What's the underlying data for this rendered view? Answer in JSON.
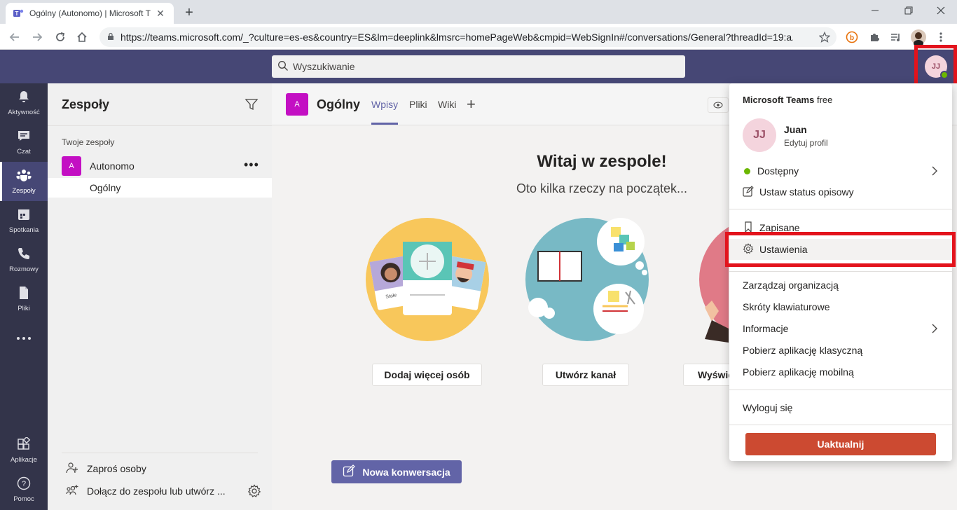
{
  "browser": {
    "tab_title": "Ogólny (Autonomo) | Microsoft T",
    "url": "https://teams.microsoft.com/_?culture=es-es&country=ES&lm=deeplink&lmsrc=homePageWeb&cmpid=WebSignIn#/conversations/General?threadId=19:a..."
  },
  "header": {
    "search_placeholder": "Wyszukiwanie",
    "avatar_initials": "JJ"
  },
  "rail": {
    "items": [
      {
        "label": "Aktywność",
        "icon": "bell-icon"
      },
      {
        "label": "Czat",
        "icon": "chat-icon"
      },
      {
        "label": "Zespoły",
        "icon": "teams-icon"
      },
      {
        "label": "Spotkania",
        "icon": "calendar-icon"
      },
      {
        "label": "Rozmowy",
        "icon": "phone-icon"
      },
      {
        "label": "Pliki",
        "icon": "file-icon"
      },
      {
        "label": "",
        "icon": "more-icon"
      },
      {
        "label": "Aplikacje",
        "icon": "apps-icon"
      },
      {
        "label": "Pomoc",
        "icon": "help-icon"
      }
    ]
  },
  "panel": {
    "title": "Zespoły",
    "section_label": "Twoje zespoły",
    "team": {
      "initial": "A",
      "name": "Autonomo",
      "more": "•••"
    },
    "channel": "Ogólny",
    "invite": "Zaproś osoby",
    "join": "Dołącz do zespołu lub utwórz ..."
  },
  "channel": {
    "initial": "A",
    "name": "Ogólny",
    "tabs": [
      "Wpisy",
      "Pliki",
      "Wiki"
    ],
    "add_tab": "+"
  },
  "welcome": {
    "title": "Witaj w zespole!",
    "subtitle": "Oto kilka rzeczy na początek...",
    "card_label": "Stałe",
    "actions": [
      "Dodaj więcej osób",
      "Utwórz kanał",
      "Wyświe"
    ],
    "new_conversation": "Nowa konwersacja"
  },
  "menu": {
    "brand_bold": "Microsoft Teams",
    "brand_suffix": " free",
    "avatar_initials": "JJ",
    "user_name": "Juan",
    "edit_profile": "Edytuj profil",
    "status": "Dostępny",
    "set_status": "Ustaw status opisowy",
    "saved": "Zapisane",
    "settings": "Ustawienia",
    "manage_org": "Zarządzaj organizacją",
    "shortcuts": "Skróty klawiaturowe",
    "about": "Informacje",
    "download_desktop": "Pobierz aplikację klasyczną",
    "download_mobile": "Pobierz aplikację mobilną",
    "sign_out": "Wyloguj się",
    "upgrade": "Uaktualnij"
  },
  "colors": {
    "teams_purple": "#464775",
    "accent": "#6264a7",
    "team_tile": "#c30fc3",
    "upgrade": "#cc4a31",
    "highlight": "#e3131c",
    "presence": "#6bb700"
  }
}
